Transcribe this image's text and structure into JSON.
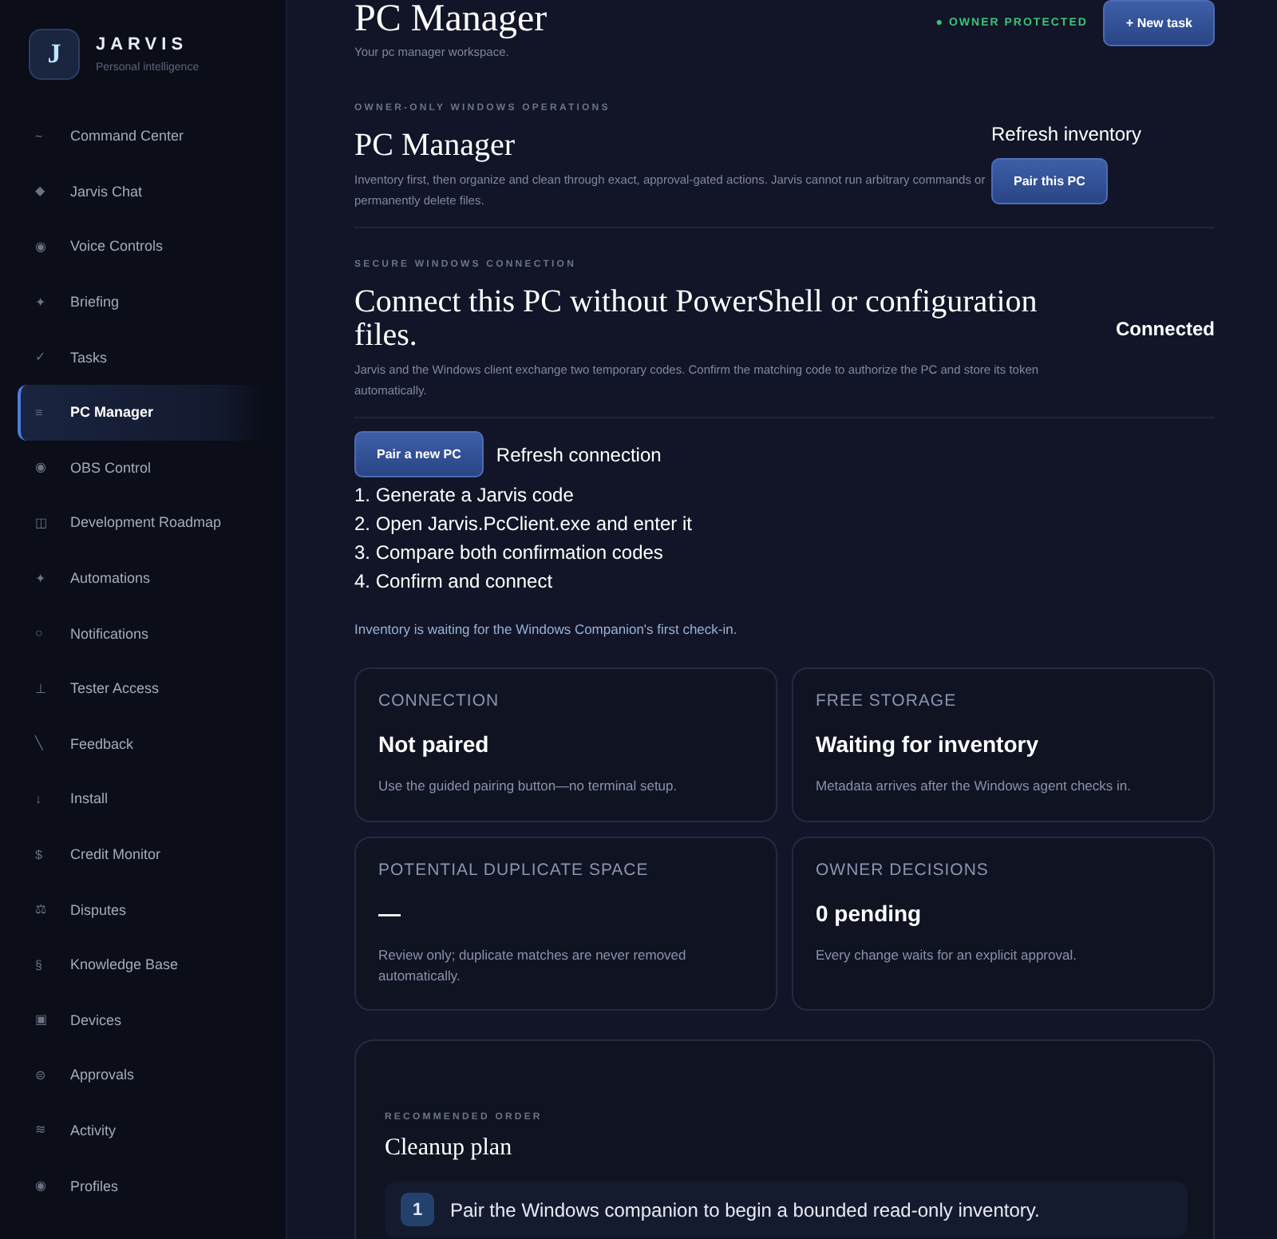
{
  "brand": {
    "logo_letter": "J",
    "name": "JARVIS",
    "tagline": "Personal intelligence"
  },
  "sidebar": {
    "items": [
      {
        "icon": "~",
        "label": "Command Center",
        "selected": false
      },
      {
        "icon": "◆",
        "label": "Jarvis Chat",
        "selected": false
      },
      {
        "icon": "◉",
        "label": "Voice Controls",
        "selected": false
      },
      {
        "icon": "✦",
        "label": "Briefing",
        "selected": false
      },
      {
        "icon": "✓",
        "label": "Tasks",
        "selected": false
      },
      {
        "icon": "≡",
        "label": "PC Manager",
        "selected": true
      },
      {
        "icon": "◉",
        "label": "OBS Control",
        "selected": false
      },
      {
        "icon": "◫",
        "label": "Development Roadmap",
        "selected": false
      },
      {
        "icon": "✦",
        "label": "Automations",
        "selected": false
      },
      {
        "icon": "○",
        "label": "Notifications",
        "selected": false
      },
      {
        "icon": "⊥",
        "label": "Tester Access",
        "selected": false
      },
      {
        "icon": "╲",
        "label": "Feedback",
        "selected": false
      },
      {
        "icon": "↓",
        "label": "Install",
        "selected": false
      },
      {
        "icon": "$",
        "label": "Credit Monitor",
        "selected": false
      },
      {
        "icon": "⚖",
        "label": "Disputes",
        "selected": false
      },
      {
        "icon": "§",
        "label": "Knowledge Base",
        "selected": false
      },
      {
        "icon": "▣",
        "label": "Devices",
        "selected": false
      },
      {
        "icon": "⊜",
        "label": "Approvals",
        "selected": false
      },
      {
        "icon": "≋",
        "label": "Activity",
        "selected": false
      },
      {
        "icon": "◉",
        "label": "Profiles",
        "selected": false
      }
    ]
  },
  "header": {
    "title": "PC Manager",
    "subtitle": "Your pc manager workspace.",
    "badge": "● OWNER PROTECTED",
    "button": "+ New task"
  },
  "operations": {
    "eyebrow": "OWNER-ONLY WINDOWS OPERATIONS",
    "title": "PC Manager",
    "description": "Inventory first, then organize and clean through exact, approval-gated actions. Jarvis cannot run arbitrary commands or permanently delete files.",
    "buttons": [
      {
        "kind": "plain",
        "label": "Refresh inventory"
      },
      {
        "kind": "primary",
        "label": "Pair this PC"
      }
    ]
  },
  "connection": {
    "eyebrow": "SECURE WINDOWS CONNECTION",
    "title": "Connect this PC without PowerShell or configuration files.",
    "status": "Connected",
    "description": "Jarvis and the Windows client exchange two temporary codes. Confirm the matching code to authorize the PC and store its token automatically.",
    "buttons": [
      {
        "kind": "primary",
        "label": "Pair a new PC"
      },
      {
        "kind": "plain",
        "label": "Refresh connection"
      }
    ],
    "steps": [
      "1. Generate a Jarvis code",
      "2. Open Jarvis.PcClient.exe and enter it",
      "3. Compare both confirmation codes",
      "4. Confirm and connect"
    ],
    "notice": "Inventory is waiting for the Windows Companion's first check-in."
  },
  "stats": [
    {
      "label": "CONNECTION",
      "value": "Not paired",
      "note": "Use the guided pairing button—no terminal setup."
    },
    {
      "label": "FREE STORAGE",
      "value": "Waiting for inventory",
      "note": "Metadata arrives after the Windows agent checks in."
    },
    {
      "label": "POTENTIAL DUPLICATE SPACE",
      "value": "—",
      "note": "Review only; duplicate matches are never removed automatically."
    },
    {
      "label": "OWNER DECISIONS",
      "value": "0 pending",
      "note": "Every change waits for an explicit approval."
    }
  ],
  "plan": {
    "eyebrow": "RECOMMENDED ORDER",
    "title": "Cleanup plan",
    "steps": [
      {
        "number": "1",
        "text": "Pair the Windows companion to begin a bounded read-only inventory."
      }
    ]
  }
}
